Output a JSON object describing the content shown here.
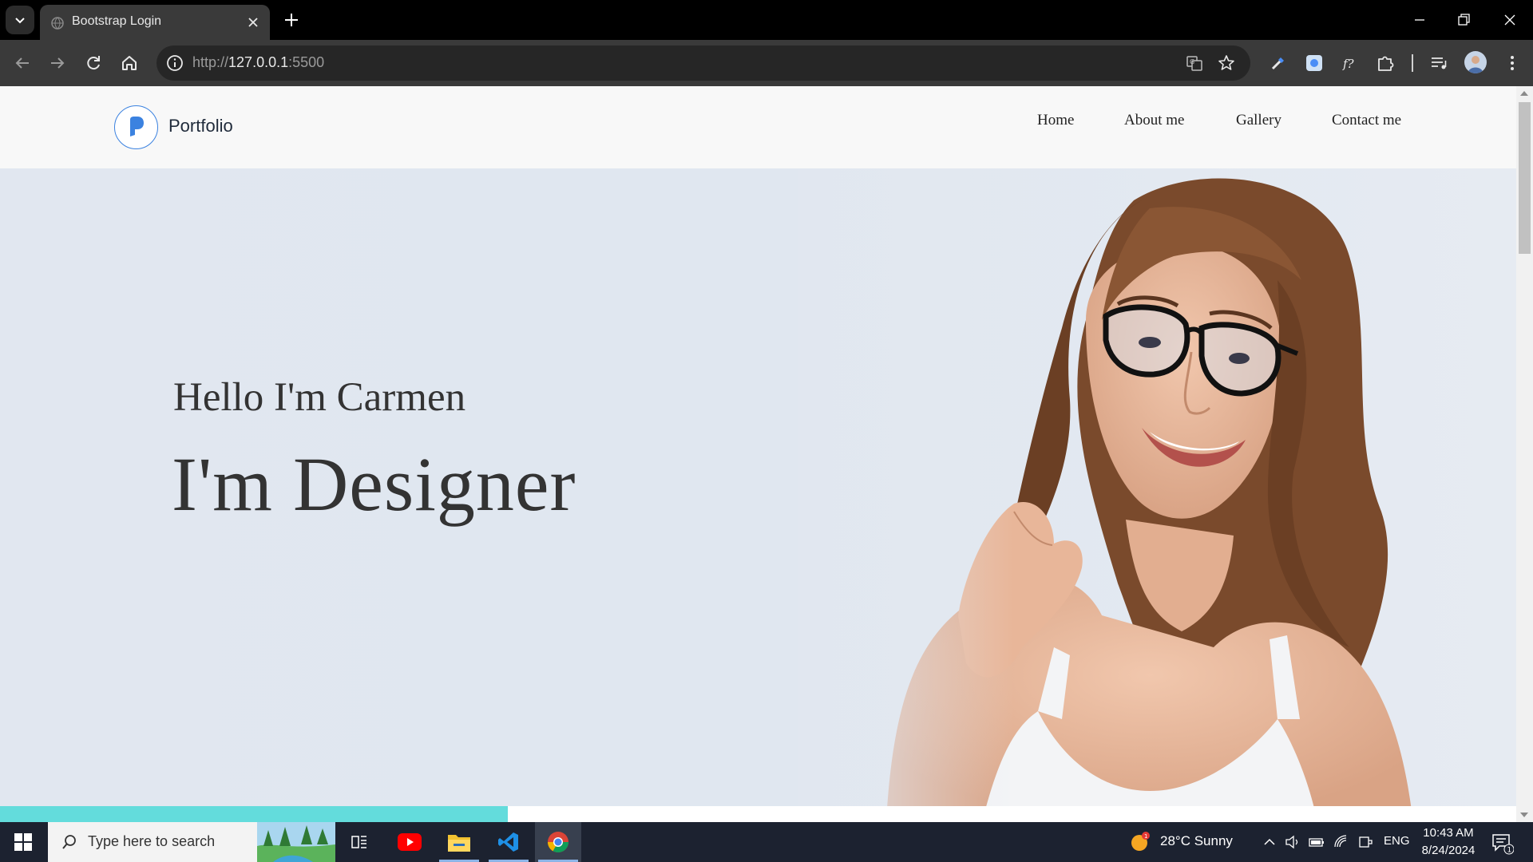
{
  "browser": {
    "tab_title": "Bootstrap Login",
    "url_scheme": "http://",
    "url_host": "127.0.0.1",
    "url_port": ":5500"
  },
  "site": {
    "brand": "Portfolio",
    "nav": [
      "Home",
      "About me",
      "Gallery",
      "Contact me"
    ]
  },
  "hero": {
    "greeting": "Hello I'm Carmen",
    "title": "I'm Designer"
  },
  "scroll_progress": 0.335,
  "colors": {
    "accent_blue": "#3b82e0",
    "progress": "#63dcdc",
    "hero_bg": "#e1e7f0"
  },
  "taskbar": {
    "search_placeholder": "Type here to search",
    "weather": "28°C  Sunny",
    "weather_badge": "1",
    "language": "ENG",
    "time": "10:43 AM",
    "date": "8/24/2024",
    "notification_count": "1",
    "apps": [
      "task-view",
      "youtube",
      "file-explorer",
      "vscode",
      "chrome"
    ]
  }
}
